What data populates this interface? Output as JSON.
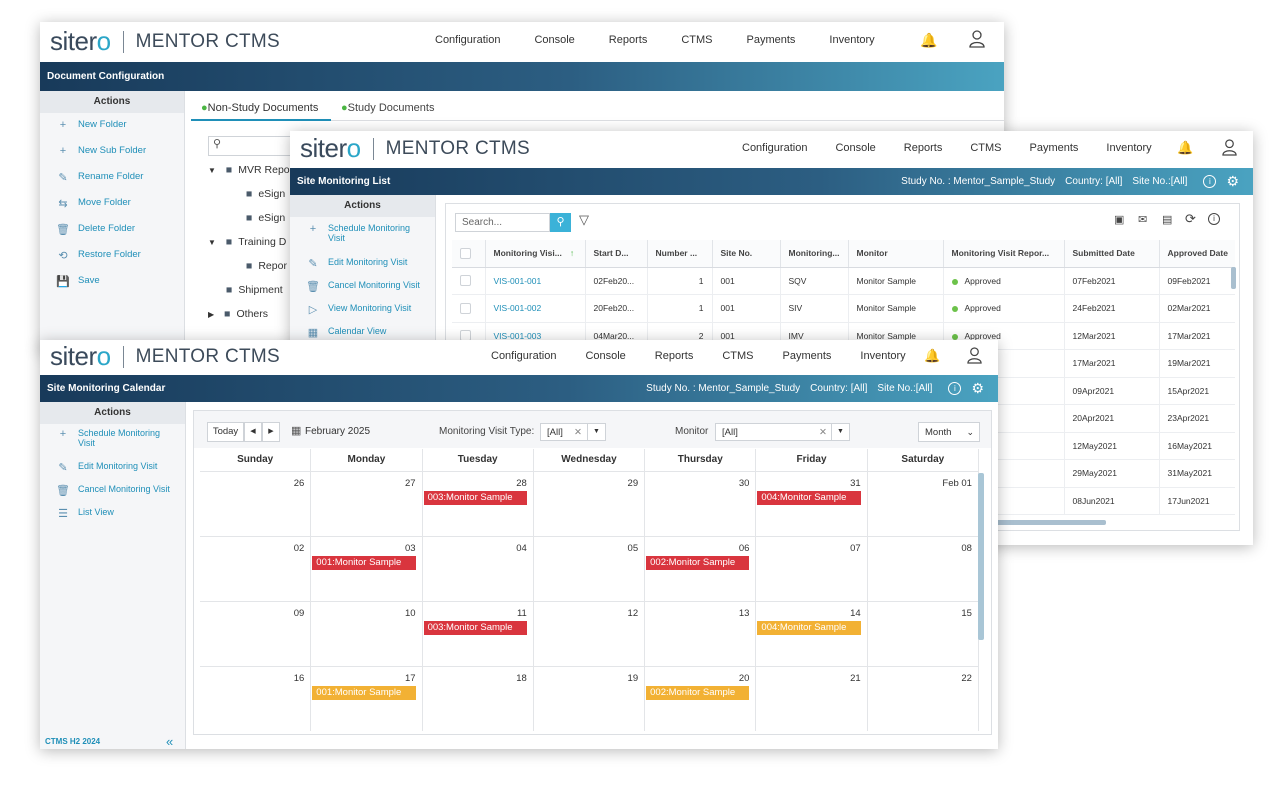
{
  "brand": {
    "name": "sitero",
    "product": "MENTOR CTMS"
  },
  "nav": [
    "Configuration",
    "Console",
    "Reports",
    "CTMS",
    "Payments",
    "Inventory"
  ],
  "doc_config": {
    "title": "Document Configuration",
    "actions_header": "Actions",
    "actions": [
      "New Folder",
      "New Sub Folder",
      "Rename Folder",
      "Move Folder",
      "Delete Folder",
      "Restore Folder",
      "Save"
    ],
    "tabs": [
      "Non-Study Documents",
      "Study Documents"
    ],
    "tree": [
      {
        "label": "MVR Reports",
        "level": 0,
        "expanded": true
      },
      {
        "label": "eSign",
        "level": 1
      },
      {
        "label": "eSign",
        "level": 1
      },
      {
        "label": "Training D",
        "level": 0,
        "expanded": true
      },
      {
        "label": "Repor",
        "level": 1
      },
      {
        "label": "Shipment",
        "level": 0
      },
      {
        "label": "Others",
        "level": 0,
        "expanded": false
      }
    ]
  },
  "list": {
    "title": "Site Monitoring List",
    "study_label": "Study No. : Mentor_Sample_Study",
    "country_label": "Country: [All]",
    "site_label": "Site No.:[All]",
    "actions_header": "Actions",
    "actions": [
      "Schedule Monitoring Visit",
      "Edit Monitoring Visit",
      "Cancel Monitoring Visit",
      "View Monitoring Visit",
      "Calendar View"
    ],
    "search_placeholder": "Search...",
    "columns": [
      "Monitoring Visi...",
      "Start D...",
      "Number ...",
      "Site No.",
      "Monitoring...",
      "Monitor",
      "Monitoring Visit Repor...",
      "Submitted Date",
      "Approved Date"
    ],
    "rows": [
      {
        "id": "VIS-001-001",
        "start": "02Feb20...",
        "number": "1",
        "site": "001",
        "type": "SQV",
        "monitor": "Monitor Sample",
        "status": "Approved",
        "submitted": "07Feb2021",
        "approved": "09Feb2021"
      },
      {
        "id": "VIS-001-002",
        "start": "20Feb20...",
        "number": "1",
        "site": "001",
        "type": "SIV",
        "monitor": "Monitor Sample",
        "status": "Approved",
        "submitted": "24Feb2021",
        "approved": "02Mar2021"
      },
      {
        "id": "VIS-001-003",
        "start": "04Mar20...",
        "number": "2",
        "site": "001",
        "type": "IMV",
        "monitor": "Monitor Sample",
        "status": "Approved",
        "submitted": "12Mar2021",
        "approved": "17Mar2021"
      },
      {
        "id": "",
        "start": "",
        "number": "",
        "site": "",
        "type": "",
        "monitor": "",
        "status": "d",
        "submitted": "17Mar2021",
        "approved": "19Mar2021"
      },
      {
        "id": "",
        "start": "",
        "number": "",
        "site": "",
        "type": "",
        "monitor": "",
        "status": "d",
        "submitted": "09Apr2021",
        "approved": "15Apr2021"
      },
      {
        "id": "",
        "start": "",
        "number": "",
        "site": "",
        "type": "",
        "monitor": "",
        "status": "d",
        "submitted": "20Apr2021",
        "approved": "23Apr2021"
      },
      {
        "id": "",
        "start": "",
        "number": "",
        "site": "",
        "type": "",
        "monitor": "",
        "status": "d",
        "submitted": "12May2021",
        "approved": "16May2021"
      },
      {
        "id": "",
        "start": "",
        "number": "",
        "site": "",
        "type": "",
        "monitor": "",
        "status": "d",
        "submitted": "29May2021",
        "approved": "31May2021"
      },
      {
        "id": "",
        "start": "",
        "number": "",
        "site": "",
        "type": "",
        "monitor": "",
        "status": "d",
        "submitted": "08Jun2021",
        "approved": "17Jun2021"
      }
    ]
  },
  "calendar": {
    "title": "Site Monitoring Calendar",
    "study_label": "Study No. : Mentor_Sample_Study",
    "country_label": "Country: [All]",
    "site_label": "Site No.:[All]",
    "actions_header": "Actions",
    "actions": [
      "Schedule Monitoring Visit",
      "Edit Monitoring Visit",
      "Cancel Monitoring Visit",
      "List View"
    ],
    "version": "CTMS H2 2024",
    "today_label": "Today",
    "month_label": "February 2025",
    "visit_type_label": "Monitoring Visit Type:",
    "visit_type_value": "[All]",
    "monitor_label": "Monitor",
    "monitor_value": "[All]",
    "view_value": "Month",
    "days": [
      "Sunday",
      "Monday",
      "Tuesday",
      "Wednesday",
      "Thursday",
      "Friday",
      "Saturday"
    ],
    "weeks": [
      [
        {
          "d": "26"
        },
        {
          "d": "27"
        },
        {
          "d": "28",
          "ev": "003:Monitor Sample",
          "c": "red"
        },
        {
          "d": "29"
        },
        {
          "d": "30"
        },
        {
          "d": "31",
          "ev": "004:Monitor Sample",
          "c": "red"
        },
        {
          "d": "Feb 01"
        }
      ],
      [
        {
          "d": "02"
        },
        {
          "d": "03",
          "ev": "001:Monitor Sample",
          "c": "red"
        },
        {
          "d": "04"
        },
        {
          "d": "05"
        },
        {
          "d": "06",
          "ev": "002:Monitor Sample",
          "c": "red"
        },
        {
          "d": "07"
        },
        {
          "d": "08"
        }
      ],
      [
        {
          "d": "09"
        },
        {
          "d": "10"
        },
        {
          "d": "11",
          "ev": "003:Monitor Sample",
          "c": "red"
        },
        {
          "d": "12"
        },
        {
          "d": "13"
        },
        {
          "d": "14",
          "ev": "004:Monitor Sample",
          "c": "orange"
        },
        {
          "d": "15"
        }
      ],
      [
        {
          "d": "16"
        },
        {
          "d": "17",
          "ev": "001:Monitor Sample",
          "c": "orange"
        },
        {
          "d": "18"
        },
        {
          "d": "19"
        },
        {
          "d": "20",
          "ev": "002:Monitor Sample",
          "c": "orange"
        },
        {
          "d": "21"
        },
        {
          "d": "22"
        }
      ]
    ]
  }
}
